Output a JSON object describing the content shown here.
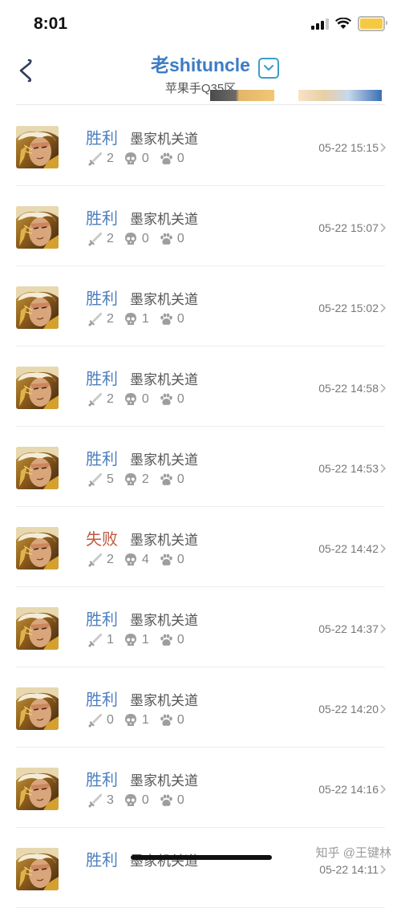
{
  "status_bar": {
    "time": "8:01"
  },
  "header": {
    "title": "老shituncle",
    "subtitle": "苹果手Q35区"
  },
  "matches": [
    {
      "result": "胜利",
      "outcome": "win",
      "mode": "墨家机关道",
      "kills": "2",
      "deaths": "0",
      "assists": "0",
      "time": "05-22 15:15"
    },
    {
      "result": "胜利",
      "outcome": "win",
      "mode": "墨家机关道",
      "kills": "2",
      "deaths": "0",
      "assists": "0",
      "time": "05-22 15:07"
    },
    {
      "result": "胜利",
      "outcome": "win",
      "mode": "墨家机关道",
      "kills": "2",
      "deaths": "1",
      "assists": "0",
      "time": "05-22 15:02"
    },
    {
      "result": "胜利",
      "outcome": "win",
      "mode": "墨家机关道",
      "kills": "2",
      "deaths": "0",
      "assists": "0",
      "time": "05-22 14:58"
    },
    {
      "result": "胜利",
      "outcome": "win",
      "mode": "墨家机关道",
      "kills": "5",
      "deaths": "2",
      "assists": "0",
      "time": "05-22 14:53"
    },
    {
      "result": "失败",
      "outcome": "lose",
      "mode": "墨家机关道",
      "kills": "2",
      "deaths": "4",
      "assists": "0",
      "time": "05-22 14:42"
    },
    {
      "result": "胜利",
      "outcome": "win",
      "mode": "墨家机关道",
      "kills": "1",
      "deaths": "1",
      "assists": "0",
      "time": "05-22 14:37"
    },
    {
      "result": "胜利",
      "outcome": "win",
      "mode": "墨家机关道",
      "kills": "0",
      "deaths": "1",
      "assists": "0",
      "time": "05-22 14:20"
    },
    {
      "result": "胜利",
      "outcome": "win",
      "mode": "墨家机关道",
      "kills": "3",
      "deaths": "0",
      "assists": "0",
      "time": "05-22 14:16"
    },
    {
      "result": "胜利",
      "outcome": "win",
      "mode": "墨家机关道",
      "kills": "",
      "deaths": "",
      "assists": "",
      "time": "05-22 14:11"
    }
  ],
  "watermark": "知乎 @王键林",
  "colors": {
    "accent": "#3c7cc4",
    "win": "#4d7fc0",
    "lose": "#c0583f"
  },
  "icons": {
    "back": "back-chevron-icon",
    "dropdown": "dropdown-icon",
    "kills": "sword-icon",
    "deaths": "skull-icon",
    "assists": "paw-icon"
  }
}
